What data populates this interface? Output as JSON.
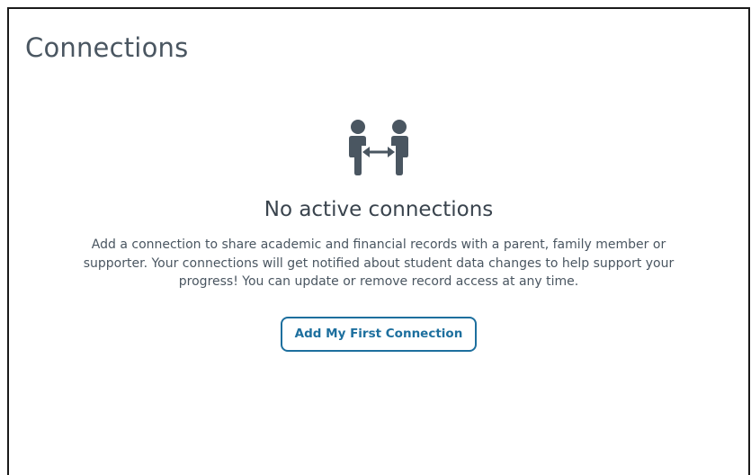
{
  "header": {
    "title": "Connections"
  },
  "empty_state": {
    "icon": "people-connection-icon",
    "title": "No active connections",
    "description": "Add a connection to share academic and financial records with a parent, family member or supporter. Your connections will get notified about student data changes to help support your progress! You can update or remove record access at any time.",
    "button_label": "Add My First Connection"
  },
  "colors": {
    "title_text": "#4a5661",
    "icon": "#4a5661",
    "button_accent": "#1d6f9e"
  }
}
